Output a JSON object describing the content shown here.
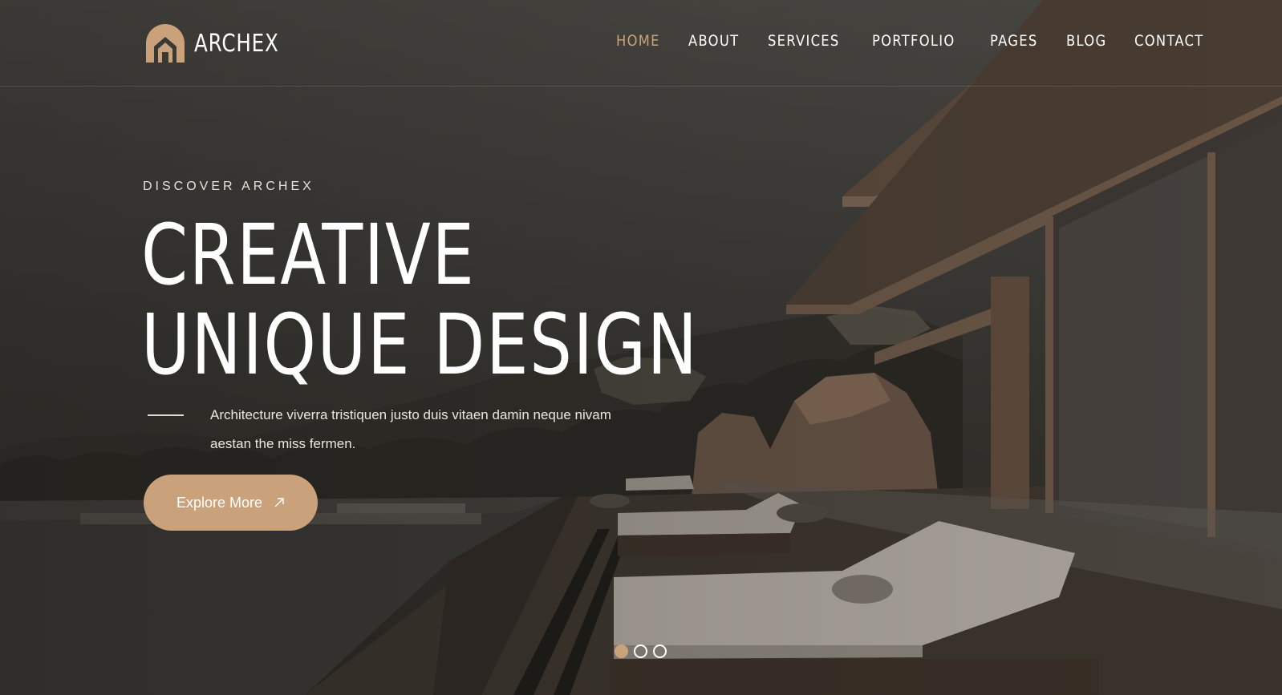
{
  "brand": {
    "name": "ARCHEX",
    "logo_icon": "house-arch-icon",
    "accent": "#c9a27c"
  },
  "nav": {
    "items": [
      {
        "label": "HOME",
        "active": true
      },
      {
        "label": "ABOUT"
      },
      {
        "label": "SERVICES"
      },
      {
        "label": "PORTFOLIO"
      },
      {
        "label": "PAGES"
      },
      {
        "label": "BLOG"
      },
      {
        "label": "CONTACT"
      }
    ]
  },
  "hero": {
    "eyebrow": "DISCOVER ARCHEX",
    "headline_line1": "CREATIVE",
    "headline_line2": "UNIQUE DESIGN",
    "description": "Architecture viverra tristiquen justo duis vitaen damin neque nivam aestan the miss fermen.",
    "cta_label": "Explore More",
    "cta_icon": "arrow-up-right-icon"
  },
  "slider": {
    "total": 3,
    "active_index": 0
  }
}
